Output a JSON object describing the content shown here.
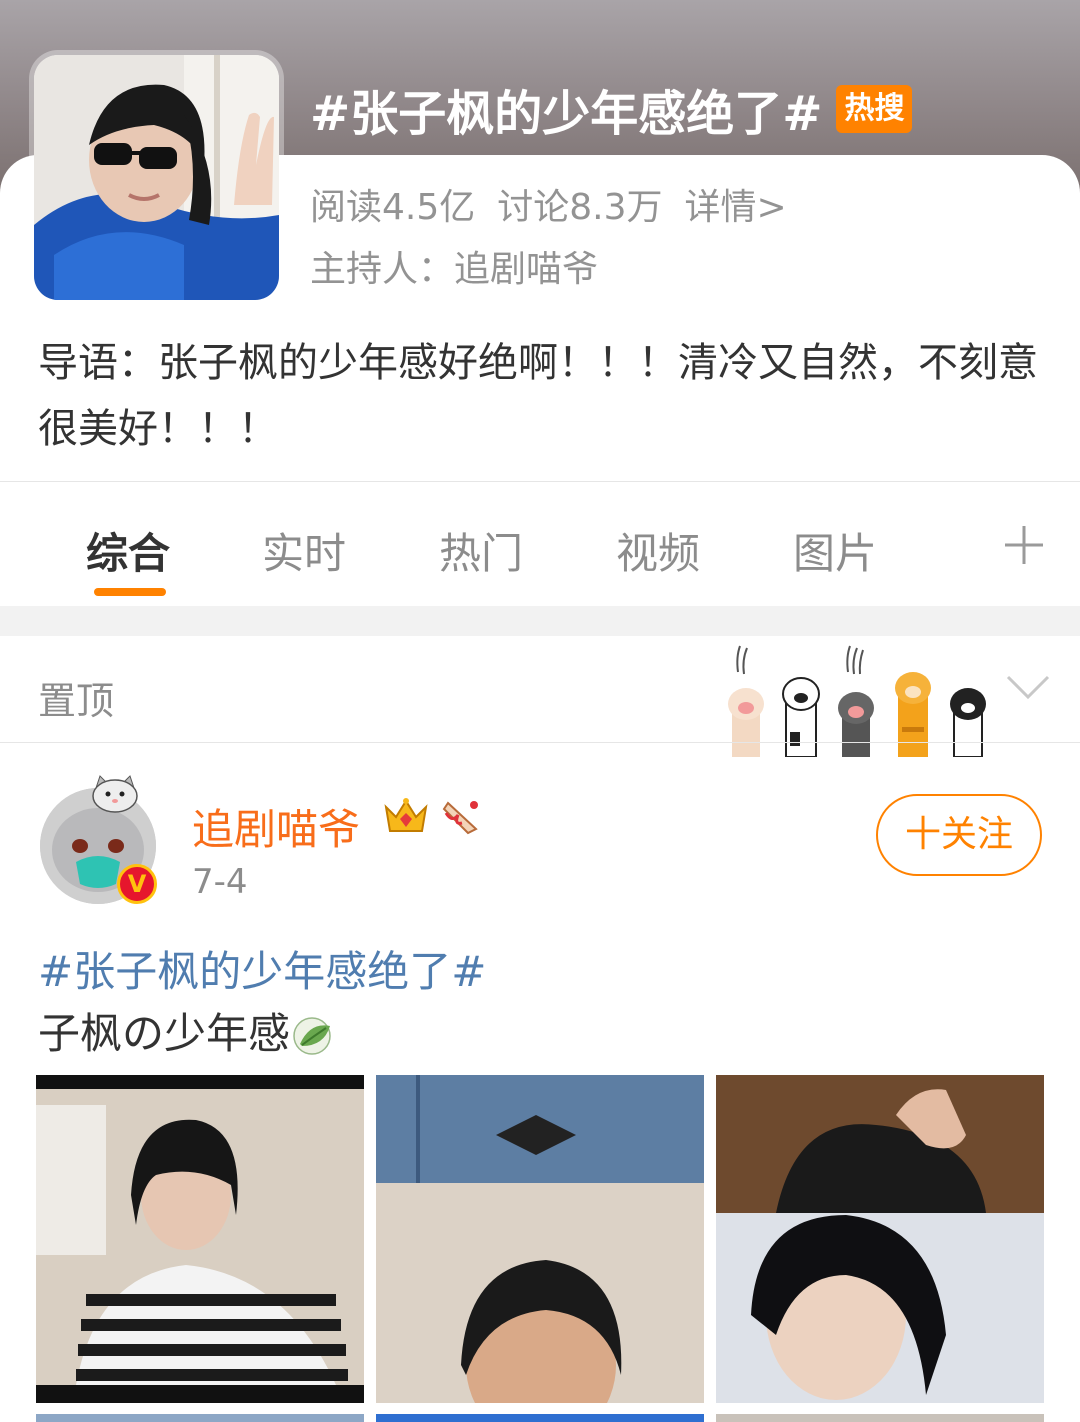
{
  "topic": {
    "title": "#张子枫的少年感绝了#",
    "hot_badge": "热搜",
    "stats": {
      "reads": "阅读4.5亿",
      "discussions": "讨论8.3万",
      "details_link": "详情>"
    },
    "host": "主持人：追剧喵爷",
    "intro": "导语：张子枫的少年感好绝啊！！！清冷又自然，不刻意很美好！！！"
  },
  "tabs": [
    {
      "label": "综合",
      "active": true
    },
    {
      "label": "实时",
      "active": false
    },
    {
      "label": "热门",
      "active": false
    },
    {
      "label": "视频",
      "active": false
    },
    {
      "label": "图片",
      "active": false
    }
  ],
  "pinned": {
    "label": "置顶"
  },
  "post": {
    "username": "追剧喵爷",
    "date": "7-4",
    "follow_label": "十关注",
    "verified_badge": "V",
    "hashtag": "#张子枫的少年感绝了#",
    "text": "子枫の少年感",
    "photos": [
      {
        "icon": "photo-striped-shirt"
      },
      {
        "icon": "photo-denim-prada"
      },
      {
        "icon": "photo-black-hoodie"
      }
    ]
  },
  "colors": {
    "accent": "#ff8200",
    "username": "#f86d1a",
    "hashtag": "#507daf",
    "muted": "#8c8c8c",
    "verified": "#e6162d"
  }
}
